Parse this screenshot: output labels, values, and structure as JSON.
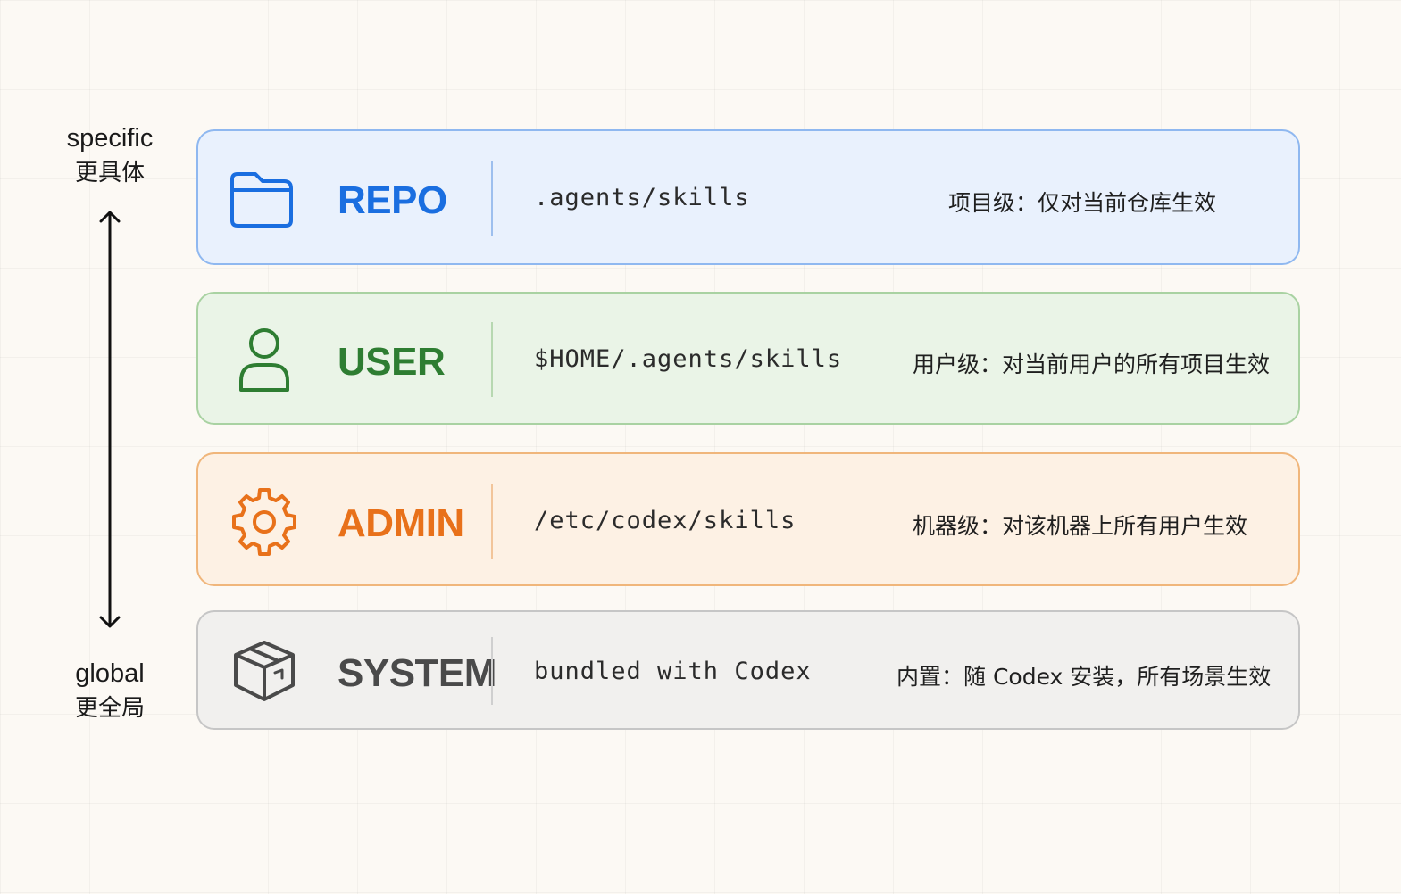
{
  "axis": {
    "top_label": "specific",
    "top_sub": "更具体",
    "bottom_label": "global",
    "bottom_sub": "更全局"
  },
  "levels": [
    {
      "key": "repo",
      "name": "REPO",
      "path": ".agents/skills",
      "description": "项目级：仅对当前仓库生效",
      "icon": "folder-icon",
      "color": "#1a6ee0"
    },
    {
      "key": "user",
      "name": "USER",
      "path": "$HOME/.agents/skills",
      "description": "用户级：对当前用户的所有项目生效",
      "icon": "user-icon",
      "color": "#2e7d32"
    },
    {
      "key": "admin",
      "name": "ADMIN",
      "path": "/etc/codex/skills",
      "description": "机器级：对该机器上所有用户生效",
      "icon": "gear-icon",
      "color": "#e8711a"
    },
    {
      "key": "system",
      "name": "SYSTEM",
      "path": "bundled with Codex",
      "description": "内置：随 Codex 安装，所有场景生效",
      "icon": "package-icon",
      "color": "#4a4a4a"
    }
  ]
}
